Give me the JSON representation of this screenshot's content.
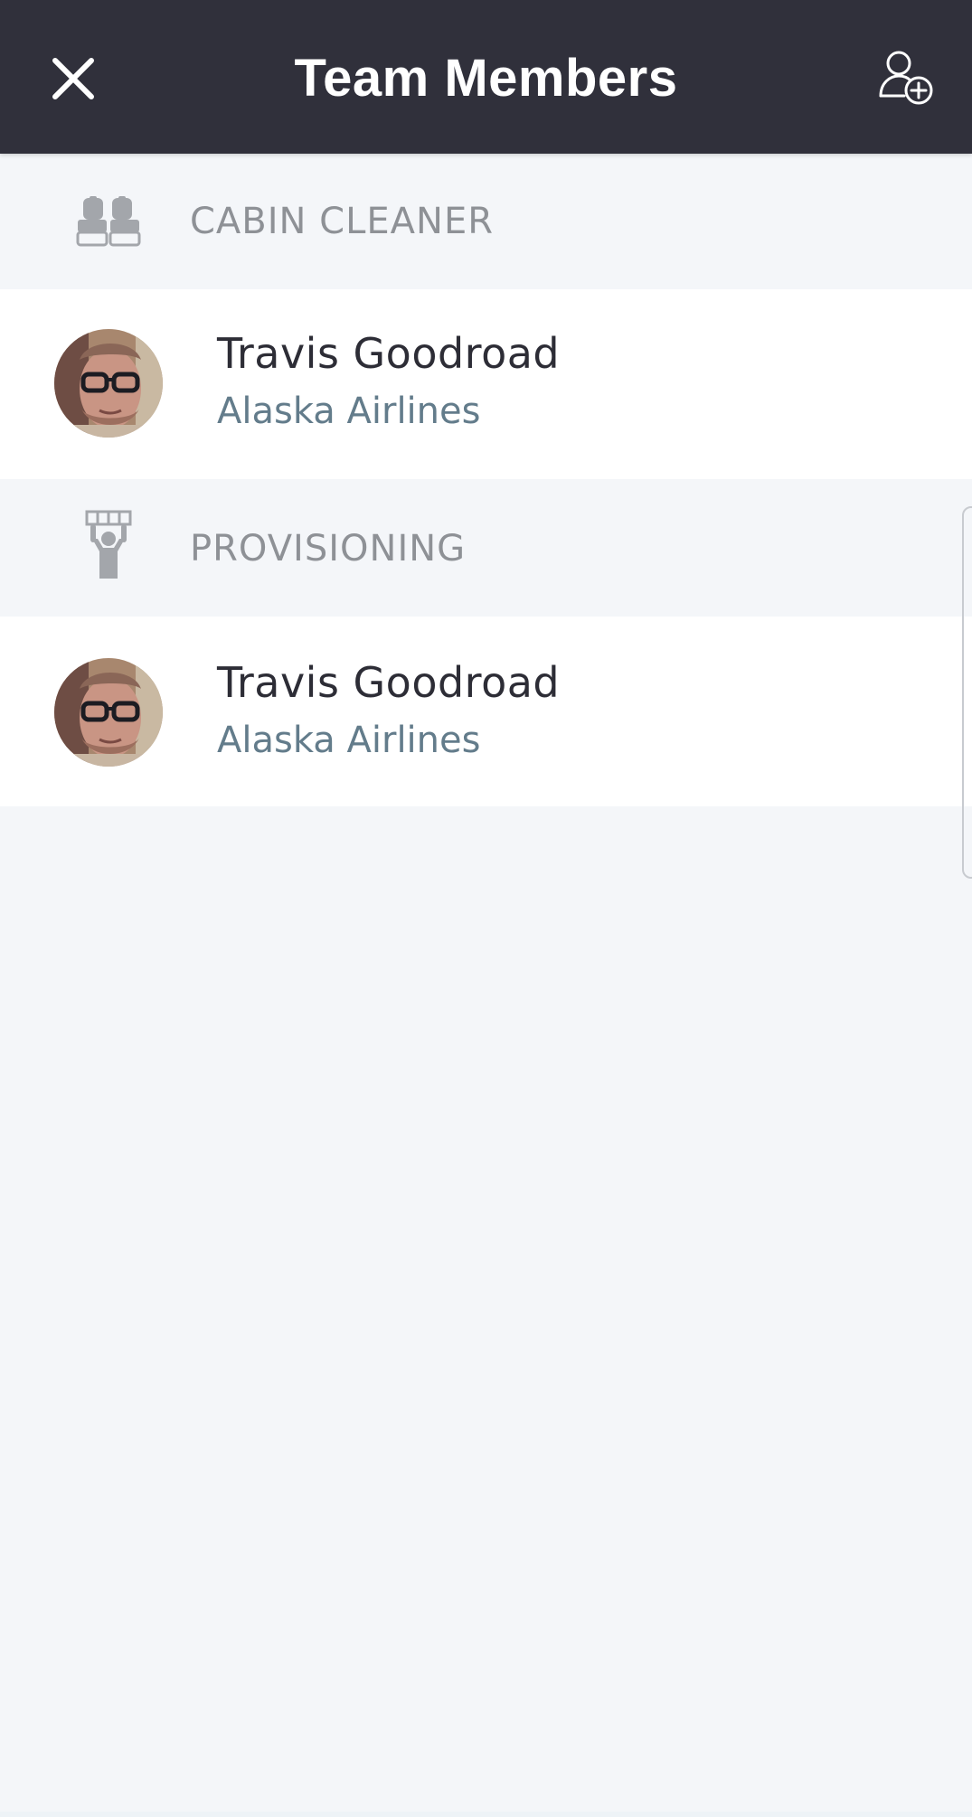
{
  "header": {
    "title": "Team Members",
    "close_icon": "close-icon",
    "add_icon": "add-user-icon"
  },
  "sections": [
    {
      "label": "CABIN CLEANER",
      "icon": "seats-icon",
      "members": [
        {
          "name": "Travis Goodroad",
          "organization": "Alaska Airlines"
        }
      ]
    },
    {
      "label": "PROVISIONING",
      "icon": "provisioning-icon",
      "members": [
        {
          "name": "Travis Goodroad",
          "organization": "Alaska Airlines"
        }
      ]
    }
  ],
  "colors": {
    "header_bg": "#30303b",
    "page_bg": "#f4f6f9",
    "section_label": "#8e9196",
    "member_name": "#2d2d36",
    "member_org": "#637c8b"
  }
}
